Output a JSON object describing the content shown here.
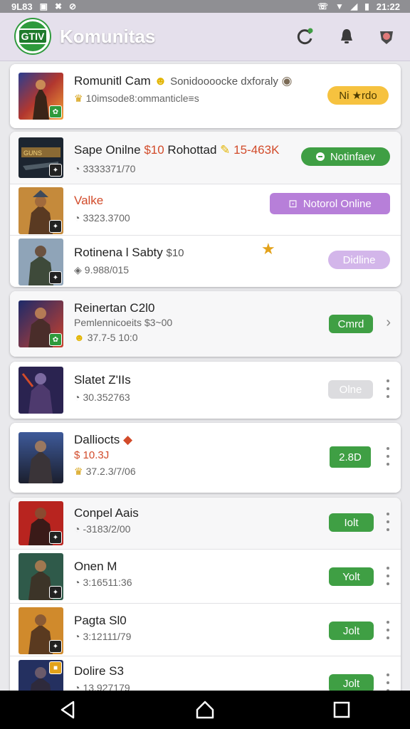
{
  "status_bar": {
    "time_left": "9L83",
    "time_right": "21:22"
  },
  "app_bar": {
    "logo_text": "GTIV",
    "title": "Komunitas"
  },
  "items": [
    {
      "title": "Romunitl Cam",
      "extra": "Sonidoooocke dxforaly",
      "sub": "10imsode8:ommanticle≡s",
      "action": "Ni ★rdo"
    },
    {
      "title": "Sape Onilne",
      "price": "$10",
      "extra": "Rohottad",
      "extra2": "15-463K",
      "sub": "3333371/70",
      "action": "Notinfaev"
    },
    {
      "title": "Valke",
      "sub": "3323.3700",
      "action": "Notorol Online"
    },
    {
      "title": "Rotinena l Sabty",
      "extra": "$10",
      "sub": "9.988/015",
      "action": "Didline"
    },
    {
      "title": "Reinertan C2l0",
      "line2": "Pemlennicoeits",
      "line2_extra": "$3~00",
      "sub": "37.7-5 10:0",
      "action": "Cmrd"
    },
    {
      "title": "Slatet Z'IIs",
      "sub": "30.352763",
      "action": "Olne"
    },
    {
      "title": "Dalliocts",
      "line2": "$ 10.3J",
      "sub": "37.2.3/7/06",
      "action": "2.8D"
    },
    {
      "title": "Conpel Aais",
      "sub": "-3183/2/00",
      "action": "Iolt"
    },
    {
      "title": "Onen M",
      "sub": "3:16511:36",
      "action": "Yolt"
    },
    {
      "title": "Pagta Sl0",
      "sub": "3:12111/79",
      "action": "Jolt"
    },
    {
      "title": "Dolire S3",
      "sub": "13.927179",
      "action": "Jolt"
    }
  ],
  "colors": {
    "green": "#3f9f44",
    "purple": "#b77fd9",
    "yellow": "#f6c23f",
    "accent_price": "#d24b2a"
  }
}
